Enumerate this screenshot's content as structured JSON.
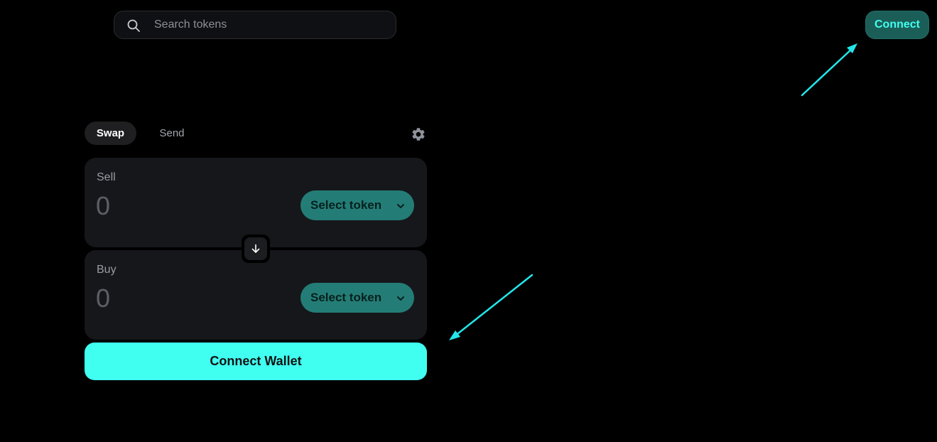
{
  "header": {
    "search": {
      "placeholder": "Search tokens",
      "value": "",
      "icon": "search-icon"
    },
    "connect_label": "Connect"
  },
  "swap_widget": {
    "tabs": [
      {
        "label": "Swap",
        "active": true
      },
      {
        "label": "Send",
        "active": false
      }
    ],
    "settings_icon": "gear-icon",
    "sell": {
      "label": "Sell",
      "amount": "0",
      "select_label": "Select token"
    },
    "buy": {
      "label": "Buy",
      "amount": "0",
      "select_label": "Select token"
    },
    "swap_direction_icon": "arrow-down-icon",
    "connect_wallet_label": "Connect Wallet"
  },
  "colors": {
    "background": "#000000",
    "accent": "#40fff0",
    "accent_dark": "#237d76",
    "panel": "#16171b",
    "annotation_arrow": "#22e6ea"
  }
}
